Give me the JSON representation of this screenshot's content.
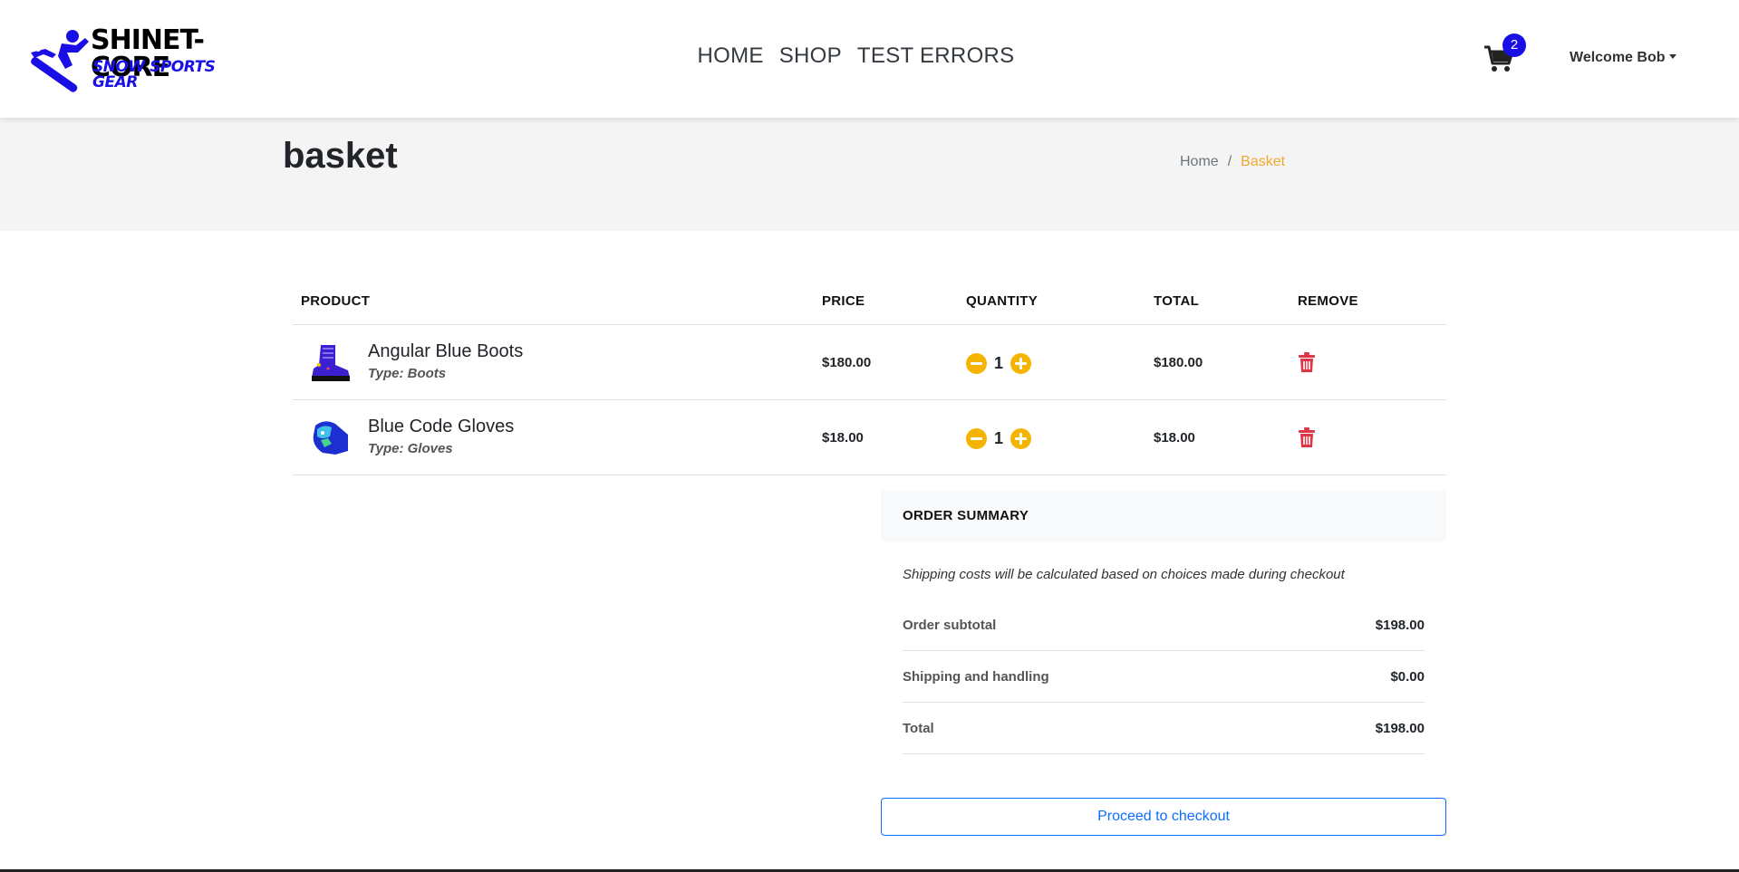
{
  "header": {
    "logo_title": "SHINET-CORE",
    "logo_subtitle": "SNOW SPORTS GEAR",
    "nav": [
      "HOME",
      "SHOP",
      "TEST ERRORS"
    ],
    "cart_icon": "shopping-cart-icon",
    "cart_count": "2",
    "user_menu": "Welcome Bob"
  },
  "page": {
    "title": "basket",
    "breadcrumb": [
      "Home",
      "Basket"
    ]
  },
  "table": {
    "headers": [
      "PRODUCT",
      "PRICE",
      "QUANTITY",
      "TOTAL",
      "REMOVE"
    ],
    "rows": [
      {
        "name": "Angular Blue Boots",
        "type": "Type: Boots",
        "price": "$180.00",
        "quantity": "1",
        "total": "$180.00",
        "image": "boot-image"
      },
      {
        "name": "Blue Code Gloves",
        "type": "Type: Gloves",
        "price": "$18.00",
        "quantity": "1",
        "total": "$18.00",
        "image": "glove-image"
      }
    ]
  },
  "summary": {
    "heading": "ORDER SUMMARY",
    "note": "Shipping costs will be calculated based on choices made during checkout",
    "rows": [
      {
        "label": "Order subtotal",
        "value": "$198.00"
      },
      {
        "label": "Shipping and handling",
        "value": "$0.00"
      },
      {
        "label": "Total",
        "value": "$198.00"
      }
    ],
    "checkout_label": "Proceed to checkout"
  },
  "colors": {
    "accent_blue": "#1a0ee6",
    "quantity_button": "#f5b400",
    "remove_icon": "#dc3545",
    "breadcrumb_active": "#f0a830",
    "checkout_border": "#0d6efd"
  }
}
